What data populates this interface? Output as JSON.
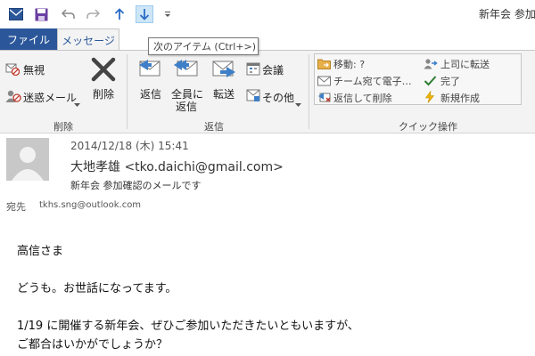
{
  "window": {
    "title": "新年会 参加"
  },
  "tabs": {
    "file": "ファイル",
    "message": "メッセージ"
  },
  "tooltip": "次のアイテム (Ctrl+>)",
  "ribbon": {
    "delete_group": {
      "ignore": "無視",
      "junk": "迷惑メール",
      "delete": "削除",
      "label": "削除"
    },
    "respond_group": {
      "reply": "返信",
      "reply_all_1": "全員に",
      "reply_all_2": "返信",
      "forward": "転送",
      "meeting": "会議",
      "more": "その他",
      "label": "返信"
    },
    "quick_steps": {
      "move": "移動: ?",
      "team": "チーム宛て電子…",
      "reply_delete": "返信して削除",
      "to_manager": "上司に転送",
      "done": "完了",
      "create_new": "新規作成",
      "label": "クイック操作"
    }
  },
  "message": {
    "date": "2014/12/18 (木) 15:41",
    "sender": "大地孝雄 <tko.daichi@gmail.com>",
    "subject": "新年会 参加確認のメールです",
    "to_label": "宛先",
    "to_address": "tkhs.sng@outlook.com",
    "body": {
      "greeting": "高信さま",
      "line1": "どうも。お世話になってます。",
      "line2": "1/19 に開催する新年会、ぜひご参加いただきたいともいますが、",
      "line3": "ご都合はいかがでしょうか？"
    }
  },
  "colors": {
    "accent": "#2b579a",
    "reply_arrow": "#3f7fc8",
    "forward_arrow": "#3f7fc8",
    "delete_x": "#444444"
  }
}
